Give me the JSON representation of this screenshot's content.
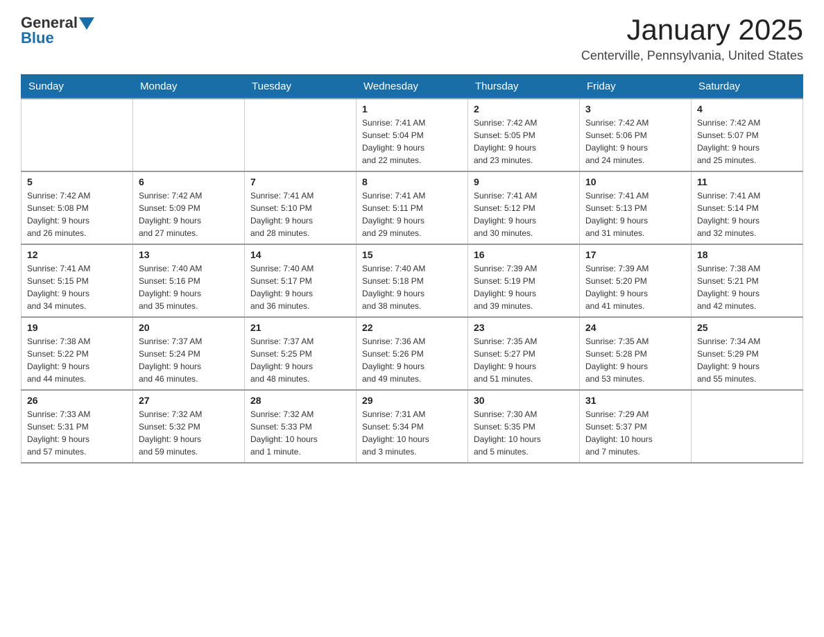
{
  "header": {
    "logo_general": "General",
    "logo_blue": "Blue",
    "title": "January 2025",
    "subtitle": "Centerville, Pennsylvania, United States"
  },
  "days_of_week": [
    "Sunday",
    "Monday",
    "Tuesday",
    "Wednesday",
    "Thursday",
    "Friday",
    "Saturday"
  ],
  "weeks": [
    [
      {
        "day": "",
        "info": ""
      },
      {
        "day": "",
        "info": ""
      },
      {
        "day": "",
        "info": ""
      },
      {
        "day": "1",
        "info": "Sunrise: 7:41 AM\nSunset: 5:04 PM\nDaylight: 9 hours\nand 22 minutes."
      },
      {
        "day": "2",
        "info": "Sunrise: 7:42 AM\nSunset: 5:05 PM\nDaylight: 9 hours\nand 23 minutes."
      },
      {
        "day": "3",
        "info": "Sunrise: 7:42 AM\nSunset: 5:06 PM\nDaylight: 9 hours\nand 24 minutes."
      },
      {
        "day": "4",
        "info": "Sunrise: 7:42 AM\nSunset: 5:07 PM\nDaylight: 9 hours\nand 25 minutes."
      }
    ],
    [
      {
        "day": "5",
        "info": "Sunrise: 7:42 AM\nSunset: 5:08 PM\nDaylight: 9 hours\nand 26 minutes."
      },
      {
        "day": "6",
        "info": "Sunrise: 7:42 AM\nSunset: 5:09 PM\nDaylight: 9 hours\nand 27 minutes."
      },
      {
        "day": "7",
        "info": "Sunrise: 7:41 AM\nSunset: 5:10 PM\nDaylight: 9 hours\nand 28 minutes."
      },
      {
        "day": "8",
        "info": "Sunrise: 7:41 AM\nSunset: 5:11 PM\nDaylight: 9 hours\nand 29 minutes."
      },
      {
        "day": "9",
        "info": "Sunrise: 7:41 AM\nSunset: 5:12 PM\nDaylight: 9 hours\nand 30 minutes."
      },
      {
        "day": "10",
        "info": "Sunrise: 7:41 AM\nSunset: 5:13 PM\nDaylight: 9 hours\nand 31 minutes."
      },
      {
        "day": "11",
        "info": "Sunrise: 7:41 AM\nSunset: 5:14 PM\nDaylight: 9 hours\nand 32 minutes."
      }
    ],
    [
      {
        "day": "12",
        "info": "Sunrise: 7:41 AM\nSunset: 5:15 PM\nDaylight: 9 hours\nand 34 minutes."
      },
      {
        "day": "13",
        "info": "Sunrise: 7:40 AM\nSunset: 5:16 PM\nDaylight: 9 hours\nand 35 minutes."
      },
      {
        "day": "14",
        "info": "Sunrise: 7:40 AM\nSunset: 5:17 PM\nDaylight: 9 hours\nand 36 minutes."
      },
      {
        "day": "15",
        "info": "Sunrise: 7:40 AM\nSunset: 5:18 PM\nDaylight: 9 hours\nand 38 minutes."
      },
      {
        "day": "16",
        "info": "Sunrise: 7:39 AM\nSunset: 5:19 PM\nDaylight: 9 hours\nand 39 minutes."
      },
      {
        "day": "17",
        "info": "Sunrise: 7:39 AM\nSunset: 5:20 PM\nDaylight: 9 hours\nand 41 minutes."
      },
      {
        "day": "18",
        "info": "Sunrise: 7:38 AM\nSunset: 5:21 PM\nDaylight: 9 hours\nand 42 minutes."
      }
    ],
    [
      {
        "day": "19",
        "info": "Sunrise: 7:38 AM\nSunset: 5:22 PM\nDaylight: 9 hours\nand 44 minutes."
      },
      {
        "day": "20",
        "info": "Sunrise: 7:37 AM\nSunset: 5:24 PM\nDaylight: 9 hours\nand 46 minutes."
      },
      {
        "day": "21",
        "info": "Sunrise: 7:37 AM\nSunset: 5:25 PM\nDaylight: 9 hours\nand 48 minutes."
      },
      {
        "day": "22",
        "info": "Sunrise: 7:36 AM\nSunset: 5:26 PM\nDaylight: 9 hours\nand 49 minutes."
      },
      {
        "day": "23",
        "info": "Sunrise: 7:35 AM\nSunset: 5:27 PM\nDaylight: 9 hours\nand 51 minutes."
      },
      {
        "day": "24",
        "info": "Sunrise: 7:35 AM\nSunset: 5:28 PM\nDaylight: 9 hours\nand 53 minutes."
      },
      {
        "day": "25",
        "info": "Sunrise: 7:34 AM\nSunset: 5:29 PM\nDaylight: 9 hours\nand 55 minutes."
      }
    ],
    [
      {
        "day": "26",
        "info": "Sunrise: 7:33 AM\nSunset: 5:31 PM\nDaylight: 9 hours\nand 57 minutes."
      },
      {
        "day": "27",
        "info": "Sunrise: 7:32 AM\nSunset: 5:32 PM\nDaylight: 9 hours\nand 59 minutes."
      },
      {
        "day": "28",
        "info": "Sunrise: 7:32 AM\nSunset: 5:33 PM\nDaylight: 10 hours\nand 1 minute."
      },
      {
        "day": "29",
        "info": "Sunrise: 7:31 AM\nSunset: 5:34 PM\nDaylight: 10 hours\nand 3 minutes."
      },
      {
        "day": "30",
        "info": "Sunrise: 7:30 AM\nSunset: 5:35 PM\nDaylight: 10 hours\nand 5 minutes."
      },
      {
        "day": "31",
        "info": "Sunrise: 7:29 AM\nSunset: 5:37 PM\nDaylight: 10 hours\nand 7 minutes."
      },
      {
        "day": "",
        "info": ""
      }
    ]
  ]
}
